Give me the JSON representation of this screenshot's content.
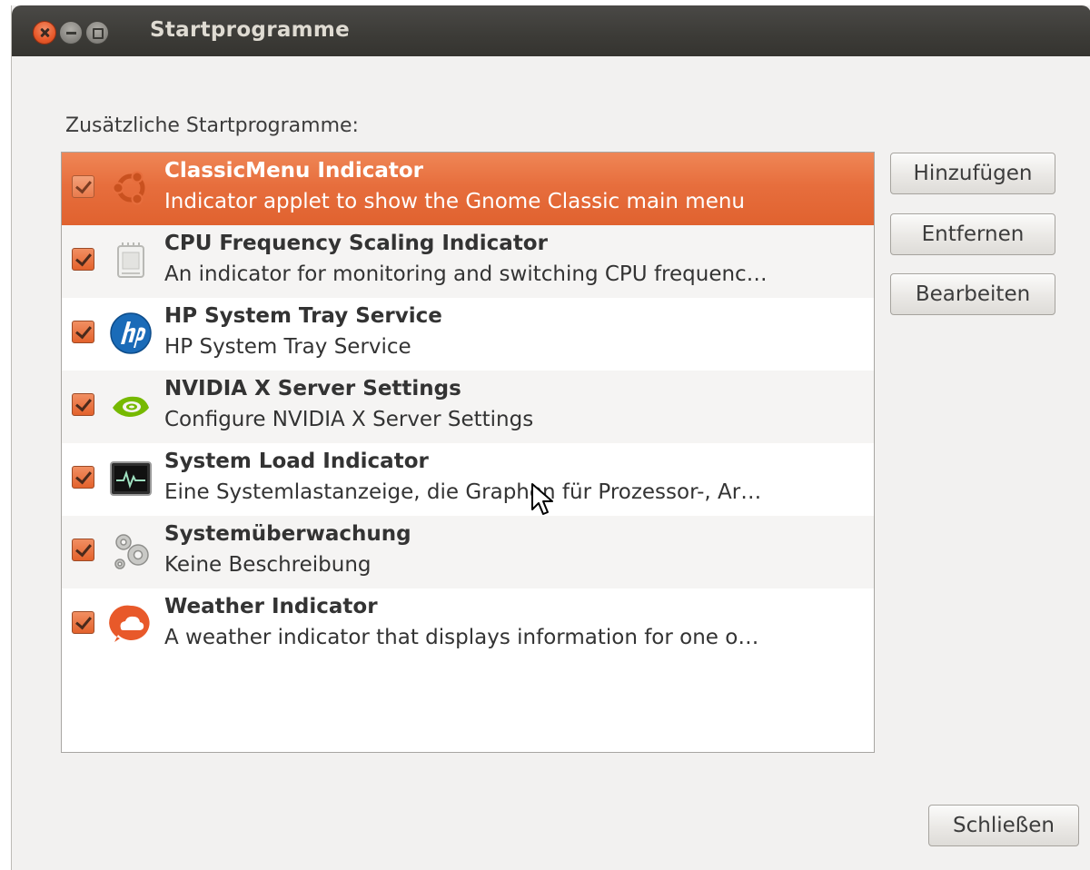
{
  "window": {
    "title": "Startprogramme"
  },
  "section_label": "Zusätzliche Startprogramme:",
  "programs": [
    {
      "name": "ClassicMenu Indicator",
      "description": "Indicator applet to show the Gnome Classic main menu",
      "enabled": true,
      "selected": true,
      "icon": "ubuntu-logo-icon"
    },
    {
      "name": "CPU Frequency Scaling Indicator",
      "description": "An indicator for monitoring and switching CPU frequenc…",
      "enabled": true,
      "selected": false,
      "icon": "cpu-chip-icon"
    },
    {
      "name": "HP System Tray Service",
      "description": "HP System Tray Service",
      "enabled": true,
      "selected": false,
      "icon": "hp-logo-icon"
    },
    {
      "name": "NVIDIA X Server Settings",
      "description": "Configure NVIDIA X Server Settings",
      "enabled": true,
      "selected": false,
      "icon": "nvidia-logo-icon"
    },
    {
      "name": "System Load Indicator",
      "description": "Eine Systemlastanzeige, die Graphen für Prozessor-, Ar…",
      "enabled": true,
      "selected": false,
      "icon": "system-monitor-icon"
    },
    {
      "name": "Systemüberwachung",
      "description": "Keine Beschreibung",
      "enabled": true,
      "selected": false,
      "icon": "gears-icon"
    },
    {
      "name": "Weather Indicator",
      "description": "A weather indicator that displays information for one o…",
      "enabled": true,
      "selected": false,
      "icon": "weather-cloud-icon"
    }
  ],
  "buttons": {
    "add": "Hinzufügen",
    "remove": "Entfernen",
    "edit": "Bearbeiten",
    "close": "Schließen"
  },
  "colors": {
    "selection": "#e76e3d",
    "checkbox": "#e3622c",
    "titlebar": "#3c3b37",
    "window_bg": "#f2f1f0"
  }
}
